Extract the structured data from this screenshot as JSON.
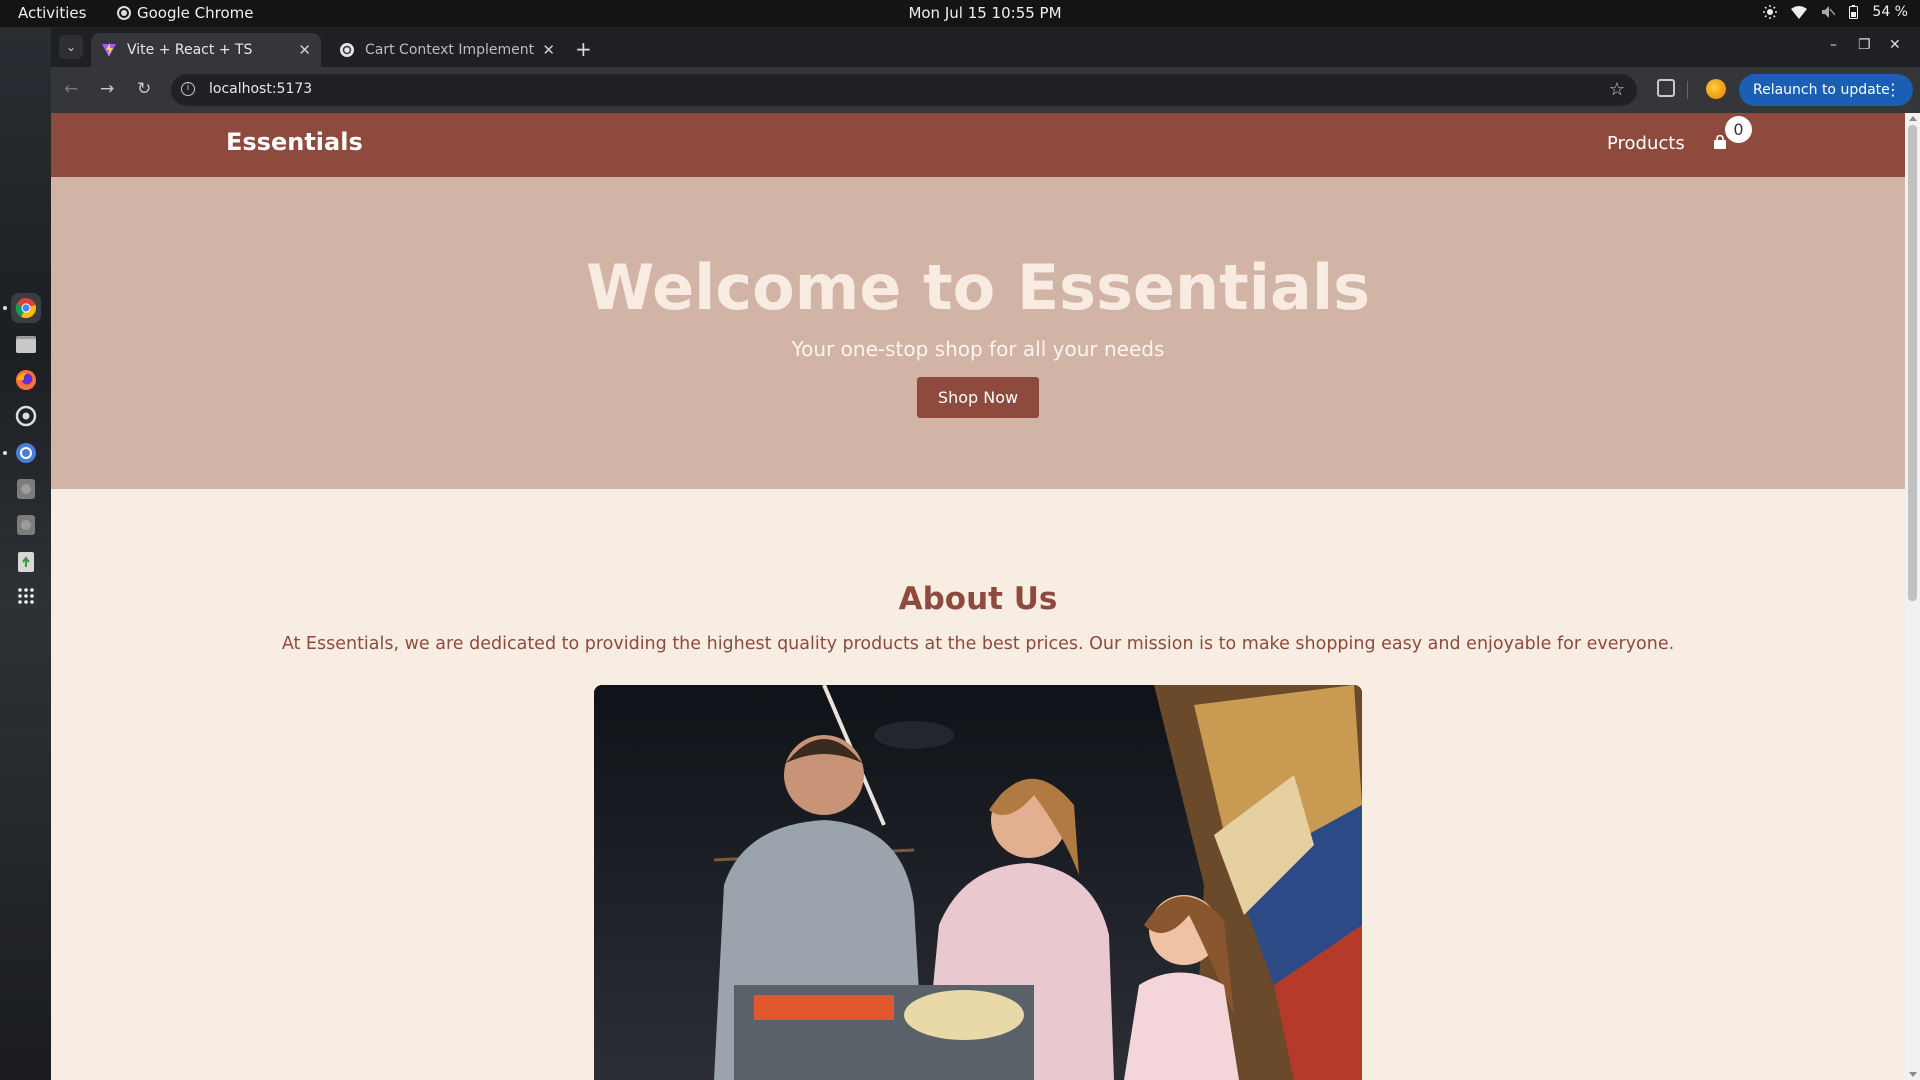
{
  "system": {
    "activities": "Activities",
    "app_name": "Google Chrome",
    "clock": "Mon Jul 15  10:55 PM",
    "battery": "54 %"
  },
  "browser": {
    "tabs": [
      {
        "title": "Vite + React + TS",
        "active": true
      },
      {
        "title": "Cart Context Implement",
        "active": false
      }
    ],
    "url": "localhost:5173",
    "relaunch_label": "Relaunch to update"
  },
  "site": {
    "brand": "Essentials",
    "nav_products": "Products",
    "cart_count": "0",
    "colors": {
      "primary": "#8e4a3d",
      "hero_bg": "#d1b4a5",
      "page_bg": "#f8ede3"
    },
    "hero": {
      "title": "Welcome to Essentials",
      "subtitle": "Your one-stop shop for all your needs",
      "cta": "Shop Now"
    },
    "about": {
      "heading": "About Us",
      "text": "At Essentials, we are dedicated to providing the highest quality products at the best prices. Our mission is to make shopping easy and enjoyable for everyone."
    }
  },
  "icons": [
    "chrome-icon",
    "files-icon",
    "firefox-icon",
    "settings-icon",
    "software-icon",
    "disk-icon",
    "disk-icon",
    "trash-icon",
    "app-grid-icon",
    "shopping-bag-icon",
    "star-icon",
    "extensions-icon"
  ]
}
